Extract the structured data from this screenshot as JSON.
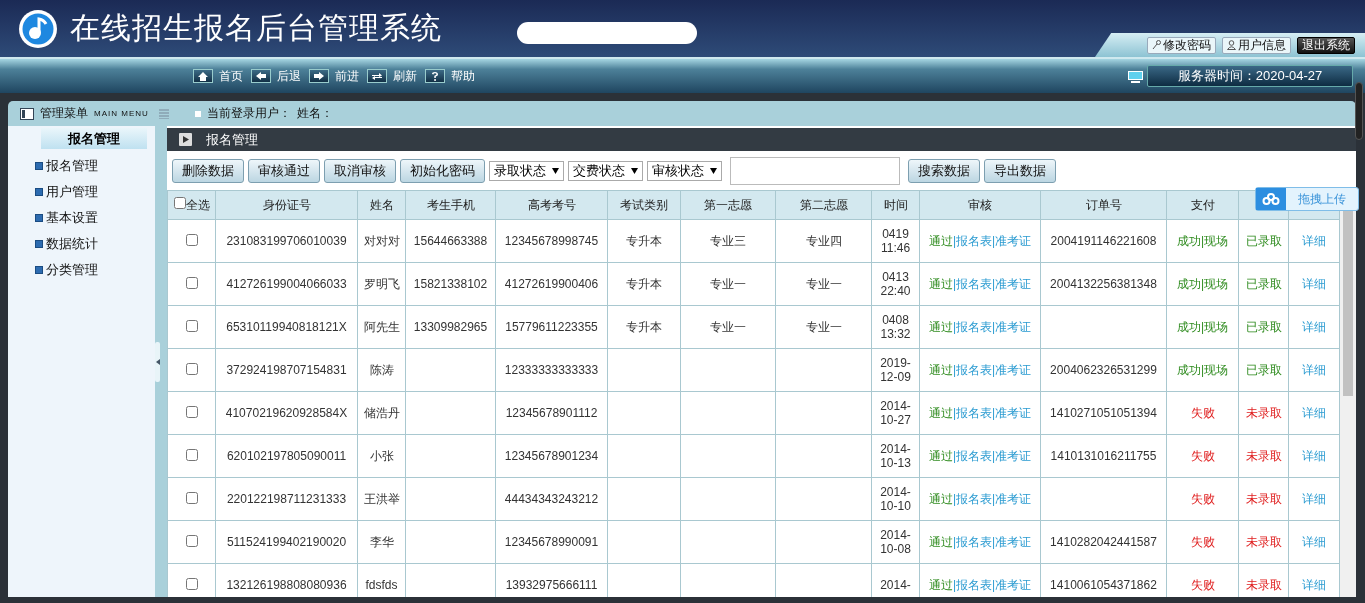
{
  "header": {
    "title": "在线招生报名后台管理系统",
    "top_buttons": [
      {
        "label": "修改密码",
        "kind": "password"
      },
      {
        "label": "用户信息",
        "kind": "user"
      },
      {
        "label": "退出系统",
        "kind": "logout"
      }
    ]
  },
  "nav": [
    "首页",
    "后退",
    "前进",
    "刷新",
    "帮助"
  ],
  "server_time": "服务器时间：2020-04-27",
  "menu_bar": {
    "title": "管理菜单",
    "subtitle": "MAIN MENU",
    "login_label": "当前登录用户：",
    "name_label": "姓名："
  },
  "sidebar": {
    "header": "报名管理",
    "items": [
      "报名管理",
      "用户管理",
      "基本设置",
      "数据统计",
      "分类管理"
    ]
  },
  "content": {
    "title": "报名管理",
    "actions": [
      "删除数据",
      "审核通过",
      "取消审核",
      "初始化密码"
    ],
    "selects": [
      "录取状态",
      "交费状态",
      "审核状态"
    ],
    "search_buttons": [
      "搜索数据",
      "导出数据"
    ]
  },
  "table": {
    "select_all": {
      "label": "全选",
      "checked": false
    },
    "columns": [
      "身份证号",
      "姓名",
      "考生手机",
      "高考考号",
      "考试类别",
      "第一志愿",
      "第二志愿",
      "时间",
      "审核",
      "订单号",
      "支付"
    ],
    "rows": [
      {
        "selected": false,
        "id": "231083199706010039",
        "name": "对对对",
        "phone": "15644663388",
        "exam_no": "12345678998745",
        "exam_type": "专升本",
        "first": "专业三",
        "second": "专业四",
        "time": "0419 11:46",
        "audit": [
          {
            "text": "通过",
            "kind": "pass"
          },
          {
            "text": "|报名表",
            "kind": "link"
          },
          {
            "text": "|准考证",
            "kind": "link"
          }
        ],
        "order": "2004191146221608",
        "pay": {
          "text": "成功|现场",
          "kind": "success"
        },
        "admit": {
          "text": "已录取",
          "kind": "success"
        },
        "detail": "详细"
      },
      {
        "selected": false,
        "id": "412726199004066033",
        "name": "罗明飞",
        "phone": "15821338102",
        "exam_no": "41272619900406",
        "exam_type": "专升本",
        "first": "专业一",
        "second": "专业一",
        "time": "0413 22:40",
        "audit": [
          {
            "text": "通过",
            "kind": "pass"
          },
          {
            "text": "|报名表",
            "kind": "link"
          },
          {
            "text": "|准考证",
            "kind": "link"
          }
        ],
        "order": "2004132256381348",
        "pay": {
          "text": "成功|现场",
          "kind": "success"
        },
        "admit": {
          "text": "已录取",
          "kind": "success"
        },
        "detail": "详细"
      },
      {
        "selected": false,
        "id": "65310119940818121X",
        "name": "阿先生",
        "phone": "13309982965",
        "exam_no": "15779611223355",
        "exam_type": "专升本",
        "first": "专业一",
        "second": "专业一",
        "time": "0408 13:32",
        "audit": [
          {
            "text": "通过",
            "kind": "pass"
          },
          {
            "text": "|报名表",
            "kind": "link"
          },
          {
            "text": "|准考证",
            "kind": "link"
          }
        ],
        "pay": {
          "text": "成功|现场",
          "kind": "success"
        },
        "admit": {
          "text": "已录取",
          "kind": "success"
        },
        "detail": "详细"
      },
      {
        "selected": false,
        "id": "372924198707154831",
        "name": "陈涛",
        "exam_no": "12333333333333",
        "time": "2019-12-09",
        "audit": [
          {
            "text": "通过",
            "kind": "pass"
          },
          {
            "text": "|报名表",
            "kind": "link"
          },
          {
            "text": "|准考证",
            "kind": "link"
          }
        ],
        "order": "2004062326531299",
        "pay": {
          "text": "成功|现场",
          "kind": "success"
        },
        "admit": {
          "text": "已录取",
          "kind": "success"
        },
        "detail": "详细"
      },
      {
        "selected": false,
        "id": "41070219620928584X",
        "name": "储浩丹",
        "exam_no": "12345678901112",
        "time": "2014-10-27",
        "audit": [
          {
            "text": "通过",
            "kind": "pass"
          },
          {
            "text": "|报名表",
            "kind": "link"
          },
          {
            "text": "|准考证",
            "kind": "link"
          }
        ],
        "order": "1410271051051394",
        "pay": {
          "text": "失败",
          "kind": "fail"
        },
        "admit": {
          "text": "未录取",
          "kind": "fail"
        },
        "detail": "详细"
      },
      {
        "selected": false,
        "id": "620102197805090011",
        "name": "小张",
        "exam_no": "12345678901234",
        "time": "2014-10-13",
        "audit": [
          {
            "text": "通过",
            "kind": "pass"
          },
          {
            "text": "|报名表",
            "kind": "link"
          },
          {
            "text": "|准考证",
            "kind": "link"
          }
        ],
        "order": "1410131016211755",
        "pay": {
          "text": "失败",
          "kind": "fail"
        },
        "admit": {
          "text": "未录取",
          "kind": "fail"
        },
        "detail": "详细"
      },
      {
        "selected": false,
        "id": "220122198711231333",
        "name": "王洪举",
        "exam_no": "44434343243212",
        "time": "2014-10-10",
        "audit": [
          {
            "text": "通过",
            "kind": "pass"
          },
          {
            "text": "|报名表",
            "kind": "link"
          },
          {
            "text": "|准考证",
            "kind": "link"
          }
        ],
        "pay": {
          "text": "失败",
          "kind": "fail"
        },
        "admit": {
          "text": "未录取",
          "kind": "fail"
        },
        "detail": "详细"
      },
      {
        "selected": false,
        "id": "511524199402190020",
        "name": "李华",
        "exam_no": "12345678990091",
        "time": "2014-10-08",
        "audit": [
          {
            "text": "通过",
            "kind": "pass"
          },
          {
            "text": "|报名表",
            "kind": "link"
          },
          {
            "text": "|准考证",
            "kind": "link"
          }
        ],
        "order": "1410282042441587",
        "pay": {
          "text": "失败",
          "kind": "fail"
        },
        "admit": {
          "text": "未录取",
          "kind": "fail"
        },
        "detail": "详细"
      },
      {
        "selected": false,
        "id": "132126198808080936",
        "name": "fdsfds",
        "exam_no": "13932975666111",
        "time": "2014-",
        "audit": [
          {
            "text": "通过",
            "kind": "pass"
          },
          {
            "text": "|报名表",
            "kind": "link"
          },
          {
            "text": "|准考证",
            "kind": "link"
          }
        ],
        "order": "1410061054371862",
        "pay": {
          "text": "失败",
          "kind": "fail"
        },
        "admit": {
          "text": "未录取",
          "kind": "fail"
        },
        "detail": "详细"
      }
    ]
  },
  "upload_widget": {
    "label": "拖拽上传"
  }
}
